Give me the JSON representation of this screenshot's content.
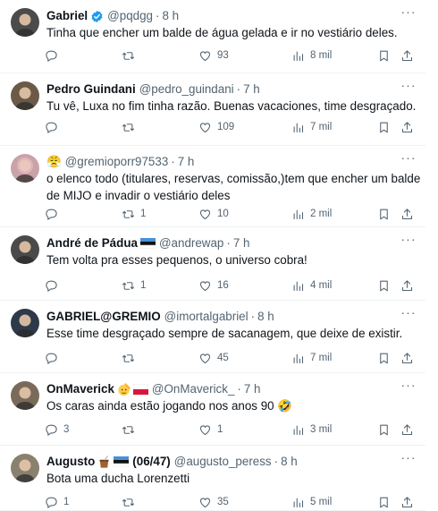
{
  "tweets": [
    {
      "name": "Gabriel",
      "badges": [
        "verified-icon"
      ],
      "handle": "@pqdgg",
      "time": "8 h",
      "text": "Tinha que encher um balde de água gelada e ir no vestiário deles.",
      "replies": "",
      "retweets": "",
      "likes": "93",
      "views": "8 mil",
      "avatar_color": "#4b4b4b"
    },
    {
      "name": "Pedro Guindani",
      "badges": [],
      "handle": "@pedro_guindani",
      "time": "7 h",
      "text": "Tu vê, Luxa no fim tinha razão. Buenas vacaciones, time desgraçado.",
      "replies": "",
      "retweets": "",
      "likes": "109",
      "views": "7 mil",
      "avatar_color": "#6b5a48"
    },
    {
      "name": "😤",
      "badges": [],
      "handle": "@gremioporr97533",
      "time": "7 h",
      "text": "o elenco todo (titulares, reservas, comissão,)tem que encher  um balde de MIJO e invadir o vestiário deles",
      "replies": "",
      "retweets": "1",
      "likes": "10",
      "views": "2 mil",
      "avatar_color": "#c9a3a8"
    },
    {
      "name": "André de Pádua",
      "badges": [
        "estonia-flag-icon"
      ],
      "handle": "@andrewap",
      "time": "7 h",
      "text": "Tem volta pra esses pequenos, o universo cobra!",
      "replies": "",
      "retweets": "1",
      "likes": "16",
      "views": "4 mil",
      "avatar_color": "#4a4a4a"
    },
    {
      "name": "GABRIEL@GREMIO",
      "badges": [],
      "handle": "@imortalgabriel",
      "time": "8 h",
      "text": "Esse time desgraçado sempre de sacanagem, que deixe de existir.",
      "replies": "",
      "retweets": "",
      "likes": "45",
      "views": "7 mil",
      "avatar_color": "#2e3a4a"
    },
    {
      "name": "OnMaverick",
      "badges": [
        "salute-emoji-icon",
        "poland-flag-icon"
      ],
      "handle": "@OnMaverick_",
      "time": "7 h",
      "text": "Os caras ainda estão jogando nos anos 90 🤣",
      "replies": "3",
      "retweets": "",
      "likes": "1",
      "views": "3 mil",
      "avatar_color": "#7a6a5a"
    },
    {
      "name": "Augusto",
      "badges": [
        "mate-icon",
        "estonia-flag-icon"
      ],
      "name_suffix": "(06/47)",
      "handle": "@augusto_peress",
      "time": "8 h",
      "text": "Bota uma ducha Lorenzetti",
      "replies": "1",
      "retweets": "",
      "likes": "35",
      "views": "5 mil",
      "avatar_color": "#8a8070"
    }
  ],
  "sep": "·",
  "more_glyph": "···"
}
